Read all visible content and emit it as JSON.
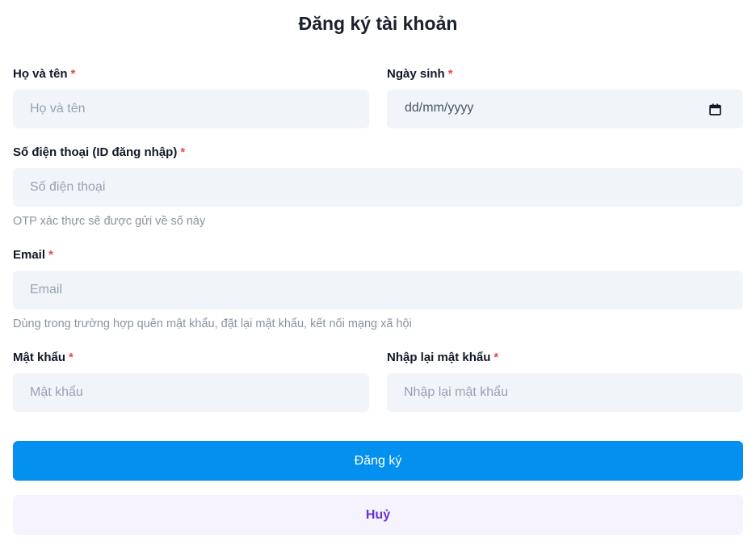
{
  "form": {
    "title": "Đăng ký tài khoản",
    "required_mark": "*",
    "full_name": {
      "label": "Họ và tên",
      "placeholder": "Họ và tên"
    },
    "birthdate": {
      "label": "Ngày sinh",
      "placeholder": "dd/mm/yyyy",
      "icon": "calendar-icon"
    },
    "phone": {
      "label": "Số điện thoại (ID đăng nhập)",
      "placeholder": "Số điện thoại",
      "hint": "OTP xác thực sẽ được gửi về số này"
    },
    "email": {
      "label": "Email",
      "placeholder": "Email",
      "hint": "Dùng trong trường hợp quên mật khẩu, đặt lại mật khẩu, kết nối mạng xã hội"
    },
    "password": {
      "label": "Mật khẩu",
      "placeholder": "Mật khẩu"
    },
    "confirm_password": {
      "label": "Nhập lại mật khẩu",
      "placeholder": "Nhập lại mật khẩu"
    },
    "submit_label": "Đăng ký",
    "cancel_label": "Huỷ"
  },
  "colors": {
    "primary": "#0390ee",
    "cancel_bg": "#f6f2fe",
    "cancel_text": "#6b2fd9",
    "required": "#e5484d",
    "field_bg": "#f1f5f9"
  }
}
